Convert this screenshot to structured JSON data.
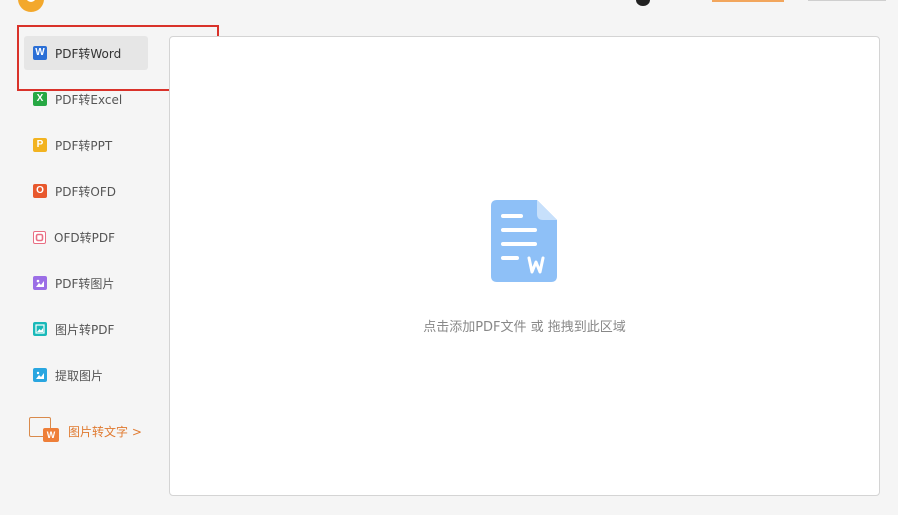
{
  "sidebar": {
    "items": [
      {
        "label": "PDF转Word",
        "icon_letter": "W",
        "icon": "word-icon",
        "color": "#2b6fd6",
        "active": true
      },
      {
        "label": "PDF转Excel",
        "icon_letter": "X",
        "icon": "excel-icon",
        "color": "#27a844"
      },
      {
        "label": "PDF转PPT",
        "icon_letter": "P",
        "icon": "ppt-icon",
        "color": "#f2b320"
      },
      {
        "label": "PDF转OFD",
        "icon_letter": "O",
        "icon": "ofd-icon",
        "color": "#e8582d"
      },
      {
        "label": "OFD转PDF",
        "icon_letter": "O",
        "icon": "ofd-outline-icon",
        "color": "#e96e83"
      },
      {
        "label": "PDF转图片",
        "icon": "image-icon",
        "color": "#9b6ee6"
      },
      {
        "label": "图片转PDF",
        "icon": "image-to-pdf-icon",
        "color": "#19b9b9"
      },
      {
        "label": "提取图片",
        "icon": "extract-image-icon",
        "color": "#29a6e0"
      }
    ],
    "promo": {
      "label": "图片转文字 >",
      "icon_letter": "W",
      "icon": "image-to-text-icon",
      "color": "#e07a30"
    }
  },
  "dropzone": {
    "hint": "点击添加PDF文件 或 拖拽到此区域",
    "icon": "word-document-icon",
    "icon_letter": "W",
    "icon_color": "#8ec0f7"
  },
  "annotation": {
    "color": "#d9322a"
  }
}
